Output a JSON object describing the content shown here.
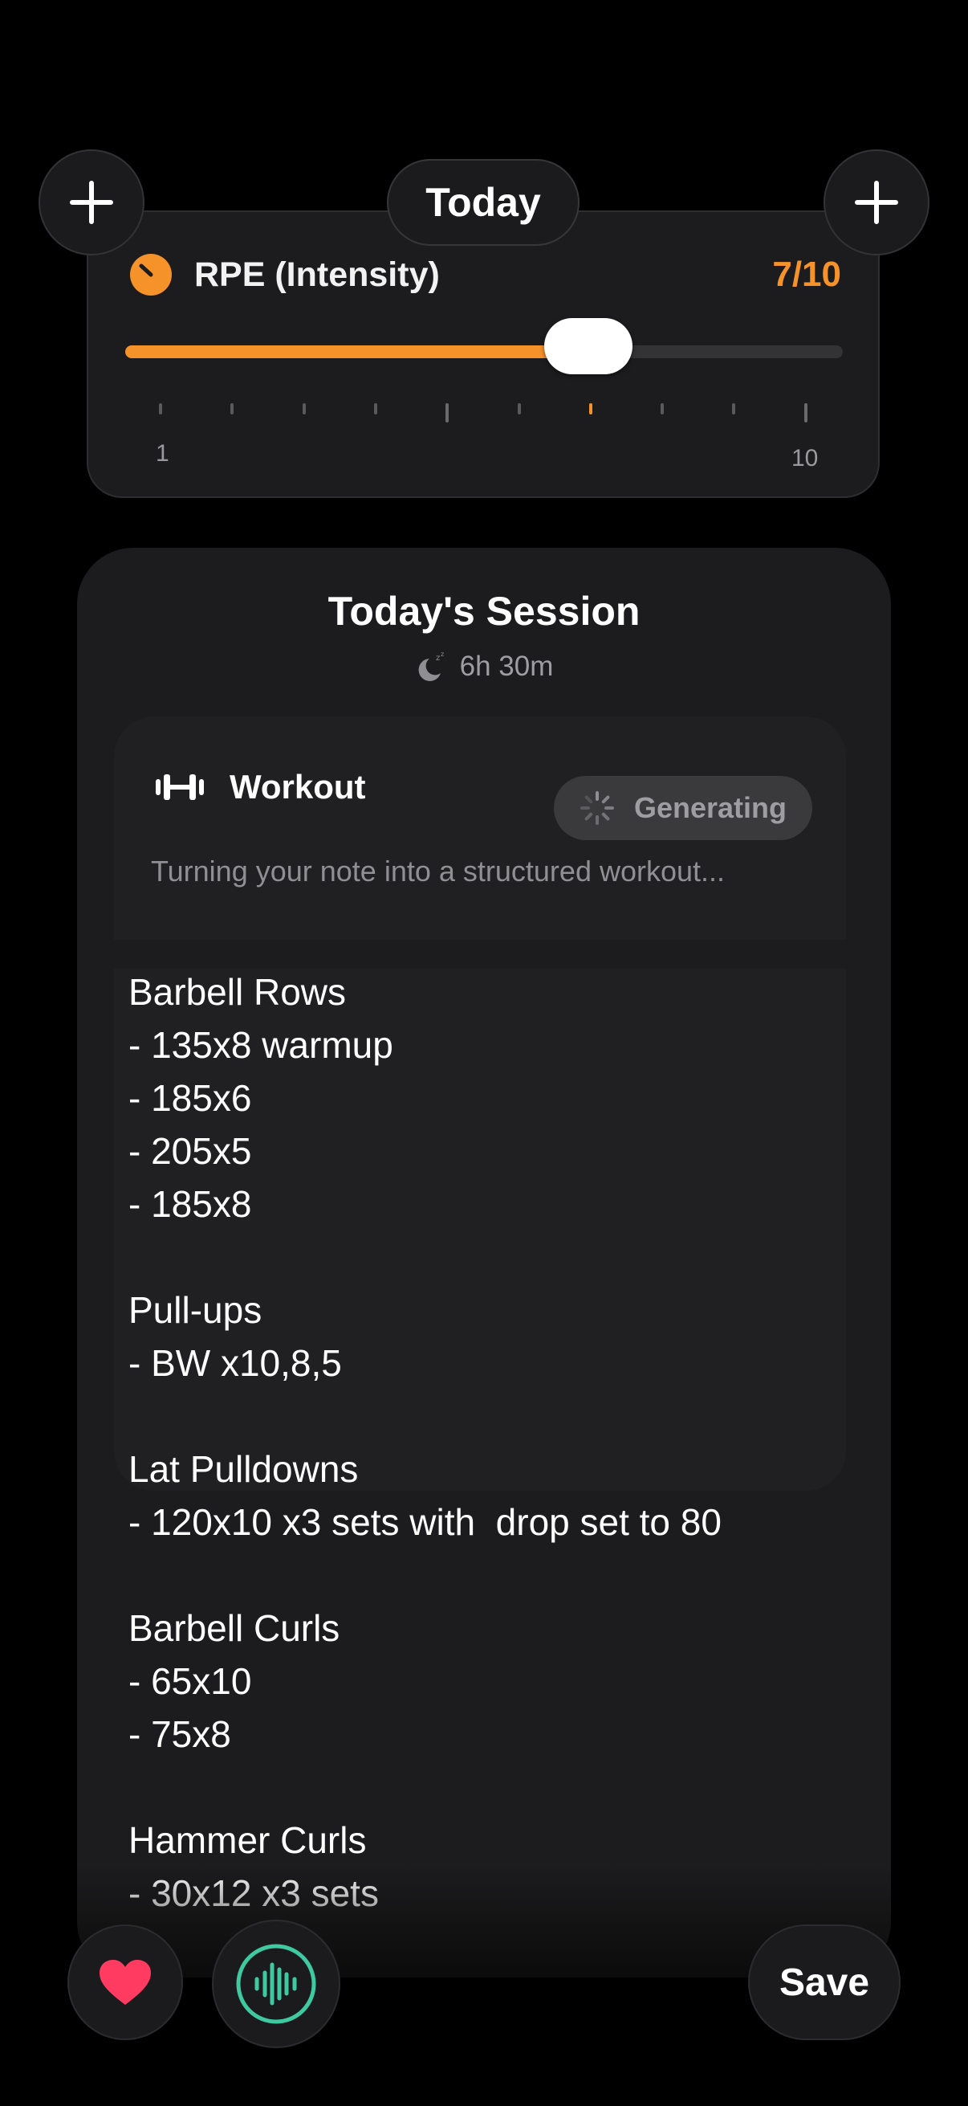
{
  "header": {
    "today_label": "Today",
    "left_add_icon": "plus-icon",
    "right_add_icon": "plus-icon"
  },
  "rpe": {
    "title": "RPE (Intensity)",
    "value_label": "7/10",
    "value": 7,
    "min": 1,
    "max": 10,
    "min_label": "1",
    "max_label": "10",
    "accent_color": "#f5922a",
    "icon": "gauge-icon"
  },
  "session": {
    "title": "Today's Session",
    "sleep_duration": "6h 30m",
    "sleep_icon": "moon-sleep-icon",
    "workout": {
      "label": "Workout",
      "icon": "dumbbell-icon",
      "status": "Generating",
      "status_icon": "spinner-icon",
      "note": "Turning your note into a structured workout..."
    },
    "notes_text": "Barbell Rows\n- 135x8 warmup\n- 185x6\n- 205x5\n- 185x8\n\nPull-ups\n- BW x10,8,5\n\nLat Pulldowns\n- 120x10 x3 sets with  drop set to 80\n\nBarbell Curls\n- 65x10\n- 75x8\n\nHammer Curls\n- 30x12 x3 sets"
  },
  "toolbar": {
    "favorite_icon": "heart-icon",
    "favorite_color": "#ff3b62",
    "voice_icon": "waveform-icon",
    "voice_color": "#3fc9a0",
    "save_label": "Save"
  }
}
